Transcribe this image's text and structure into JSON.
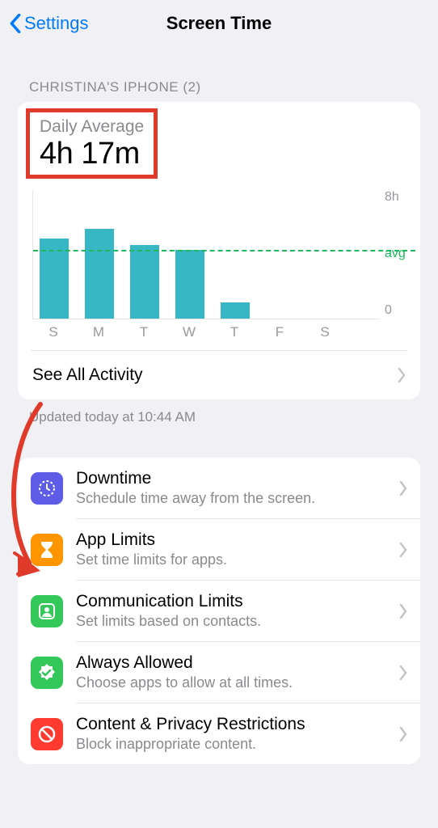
{
  "nav": {
    "back_label": "Settings",
    "title": "Screen Time"
  },
  "section_header": "CHRISTINA'S IPHONE (2)",
  "summary": {
    "avg_label": "Daily Average",
    "avg_value": "4h 17m",
    "see_all": "See All Activity",
    "updated": "Updated today at 10:44 AM"
  },
  "chart_data": {
    "type": "bar",
    "categories": [
      "S",
      "M",
      "T",
      "W",
      "T",
      "F",
      "S"
    ],
    "values": [
      5.0,
      5.6,
      4.6,
      4.3,
      1.0,
      0,
      0
    ],
    "title": "Daily Average",
    "xlabel": "",
    "ylabel": "",
    "ylim": [
      0,
      8
    ],
    "y_top_label": "8h",
    "y_bottom_label": "0",
    "avg_label": "avg",
    "avg_value": 4.28
  },
  "rows": [
    {
      "icon": "downtime",
      "color": "#5e5ce6",
      "title": "Downtime",
      "sub": "Schedule time away from the screen."
    },
    {
      "icon": "hourglass",
      "color": "#ff9500",
      "title": "App Limits",
      "sub": "Set time limits for apps."
    },
    {
      "icon": "contact",
      "color": "#34c759",
      "title": "Communication Limits",
      "sub": "Set limits based on contacts."
    },
    {
      "icon": "check-shield",
      "color": "#34c759",
      "title": "Always Allowed",
      "sub": "Choose apps to allow at all times."
    },
    {
      "icon": "no-entry",
      "color": "#ff3b30",
      "title": "Content & Privacy Restrictions",
      "sub": "Block inappropriate content."
    }
  ]
}
